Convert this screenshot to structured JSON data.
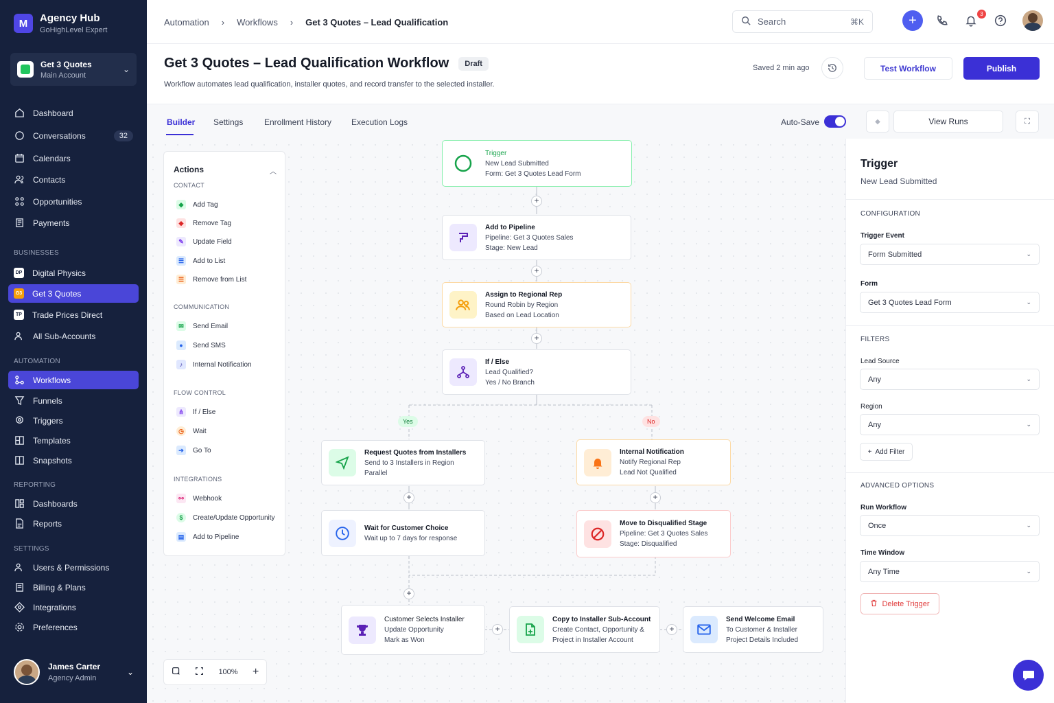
{
  "brand": {
    "name": "Agency Hub",
    "subtitle": "GoHighLevel Expert",
    "logo": "M"
  },
  "account": {
    "name": "Get 3 Quotes",
    "type": "Main Account"
  },
  "nav": {
    "main": [
      {
        "label": "Dashboard",
        "icon": "home-icon"
      },
      {
        "label": "Conversations",
        "icon": "chat-icon",
        "badge": "32"
      },
      {
        "label": "Calendars",
        "icon": "calendar-icon"
      },
      {
        "label": "Contacts",
        "icon": "contacts-icon"
      },
      {
        "label": "Opportunities",
        "icon": "opportunities-icon"
      },
      {
        "label": "Payments",
        "icon": "payments-icon"
      }
    ],
    "businesses_title": "BUSINESSES",
    "businesses": [
      {
        "label": "Digital Physics",
        "abbr": "DP"
      },
      {
        "label": "Get 3 Quotes",
        "abbr": "G3"
      },
      {
        "label": "Trade Prices Direct",
        "abbr": "TP"
      },
      {
        "label": "All Sub-Accounts",
        "abbr": ""
      }
    ],
    "automation_title": "AUTOMATION",
    "automation": [
      {
        "label": "Workflows"
      },
      {
        "label": "Funnels"
      },
      {
        "label": "Triggers"
      },
      {
        "label": "Templates"
      },
      {
        "label": "Snapshots"
      }
    ],
    "reporting_title": "REPORTING",
    "reporting": [
      {
        "label": "Dashboards"
      },
      {
        "label": "Reports"
      }
    ],
    "settings_title": "SETTINGS",
    "settings": [
      {
        "label": "Users & Permissions"
      },
      {
        "label": "Billing & Plans"
      },
      {
        "label": "Integrations"
      },
      {
        "label": "Preferences"
      }
    ]
  },
  "user": {
    "name": "James Carter",
    "role": "Agency Admin"
  },
  "breadcrumb": {
    "a": "Automation",
    "b": "Workflows",
    "c": "Get 3 Quotes – Lead Qualification"
  },
  "search": {
    "placeholder": "Search",
    "shortcut": "⌘K"
  },
  "notifications": {
    "count": "3"
  },
  "page": {
    "title": "Get 3 Quotes – Lead Qualification Workflow",
    "status": "Draft",
    "description": "Workflow automates lead qualification, installer quotes, and record transfer to the selected installer.",
    "saved": "Saved 2 min ago",
    "test_label": "Test Workflow",
    "publish_label": "Publish"
  },
  "tabs": {
    "builder": "Builder",
    "settings": "Settings",
    "enrollment": "Enrollment History",
    "logs": "Execution Logs",
    "autosave": "Auto-Save",
    "view_runs": "View Runs"
  },
  "actions_panel": {
    "title": "Actions",
    "contact_title": "CONTACT",
    "contact": [
      "Add Tag",
      "Remove Tag",
      "Update Field",
      "Add to List",
      "Remove from List"
    ],
    "communication_title": "COMMUNICATION",
    "communication": [
      "Send Email",
      "Send SMS",
      "Internal Notification"
    ],
    "flow_title": "FLOW CONTROL",
    "flow": [
      "If / Else",
      "Wait",
      "Go To"
    ],
    "integrations_title": "INTEGRATIONS",
    "integrations": [
      "Webhook",
      "Create/Update Opportunity",
      "Add to Pipeline"
    ]
  },
  "nodes": {
    "trigger": {
      "type": "Trigger",
      "l1": "New Lead Submitted",
      "l2": "Form: Get 3 Quotes Lead Form"
    },
    "pipeline": {
      "title": "Add to Pipeline",
      "l1": "Pipeline: Get 3 Quotes Sales",
      "l2": "Stage: New Lead"
    },
    "assign": {
      "title": "Assign to Regional Rep",
      "l1": "Round Robin by Region",
      "l2": "Based on Lead Location"
    },
    "ifelse": {
      "title": "If / Else",
      "l1": "Lead Qualified?",
      "l2": "Yes / No Branch"
    },
    "yes_label": "Yes",
    "no_label": "No",
    "request": {
      "title": "Request Quotes from Installers",
      "l1": "Send to 3 Installers in Region",
      "l2": "Parallel"
    },
    "notify": {
      "title": "Internal Notification",
      "l1": "Notify Regional Rep",
      "l2": "Lead Not Qualified"
    },
    "wait": {
      "title": "Wait for Customer Choice",
      "l1": "Wait up to 7 days for response"
    },
    "disq": {
      "title": "Move to Disqualified Stage",
      "l1": "Pipeline: Get 3 Quotes Sales",
      "l2": "Stage: Disqualified"
    },
    "selects": {
      "title": "Customer Selects Installer",
      "l1": "Update Opportunity",
      "l2": "Mark as Won"
    },
    "copy": {
      "title": "Copy to Installer Sub-Account",
      "l1": "Create Contact, Opportunity &",
      "l2": "Project in Installer Account"
    },
    "welcome": {
      "title": "Send Welcome Email",
      "l1": "To Customer & Installer",
      "l2": "Project Details Included"
    }
  },
  "right_panel": {
    "title": "Trigger",
    "subtitle": "New Lead Submitted",
    "config_title": "CONFIGURATION",
    "trigger_event_label": "Trigger Event",
    "trigger_event": "Form Submitted",
    "form_label": "Form",
    "form": "Get 3 Quotes Lead Form",
    "filters_title": "FILTERS",
    "lead_source_label": "Lead Source",
    "lead_source": "Any",
    "region_label": "Region",
    "region": "Any",
    "add_filter": "Add Filter",
    "advanced_title": "ADVANCED OPTIONS",
    "run_label": "Run Workflow",
    "run": "Once",
    "time_label": "Time Window",
    "time": "Any Time",
    "delete_label": "Delete Trigger"
  },
  "zoom": {
    "level": "100%"
  },
  "colors": {
    "accent": "#3b30d6",
    "sidebar": "#16213d",
    "success": "#22c55e",
    "warning": "#f59e0b",
    "danger": "#ef4444"
  }
}
